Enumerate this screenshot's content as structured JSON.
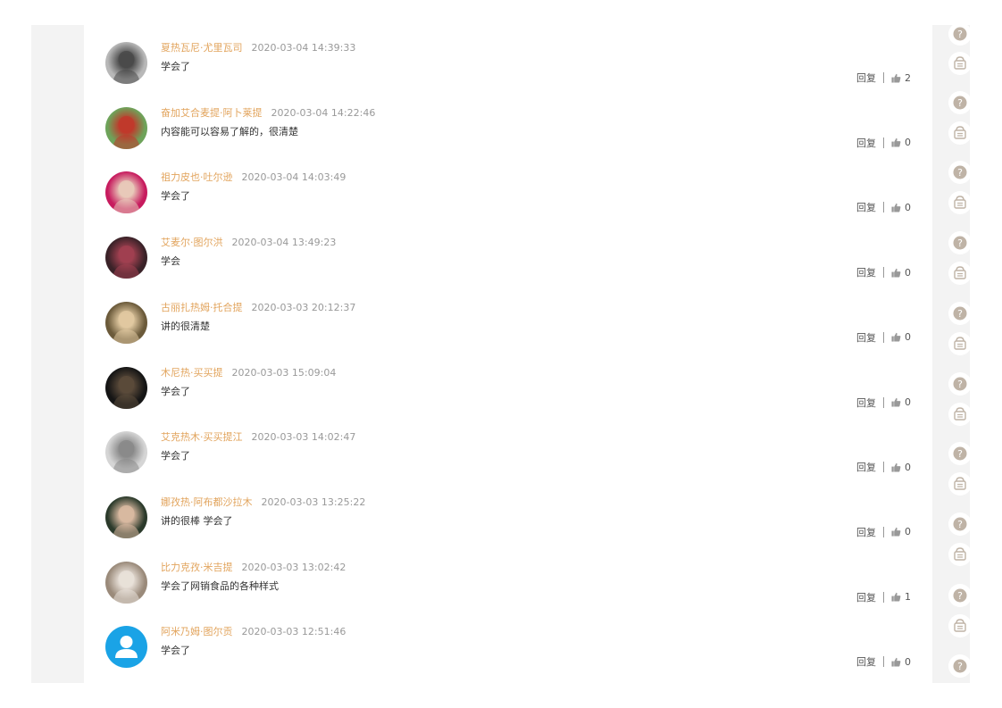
{
  "comments": [
    {
      "author": "夏热瓦尼·尤里瓦司",
      "time": "2020-03-04 14:39:33",
      "text": "学会了",
      "reply_label": "回复",
      "likes": "2",
      "avatar": {
        "kind": "photo",
        "bg": "#b8b8b8",
        "fg": "#4a4a4a"
      }
    },
    {
      "author": "奋加艾合麦提·阿卜莱提",
      "time": "2020-03-04 14:22:46",
      "text": "内容能可以容易了解的，很清楚",
      "reply_label": "回复",
      "likes": "0",
      "avatar": {
        "kind": "photo",
        "bg": "#6ea35a",
        "fg": "#c0392b"
      }
    },
    {
      "author": "祖力皮也·吐尔逊",
      "time": "2020-03-04 14:03:49",
      "text": "学会了",
      "reply_label": "回复",
      "likes": "0",
      "avatar": {
        "kind": "photo",
        "bg": "#c71b5e",
        "fg": "#e8c9b9"
      }
    },
    {
      "author": "艾麦尔·图尔洪",
      "time": "2020-03-04 13:49:23",
      "text": "学会",
      "reply_label": "回复",
      "likes": "0",
      "avatar": {
        "kind": "photo",
        "bg": "#3a2228",
        "fg": "#a04050"
      }
    },
    {
      "author": "古丽扎热姆·托合提",
      "time": "2020-03-03 20:12:37",
      "text": "讲的很清楚",
      "reply_label": "回复",
      "likes": "0",
      "avatar": {
        "kind": "photo",
        "bg": "#6b5a3a",
        "fg": "#e0c8a0"
      }
    },
    {
      "author": "木尼热·买买提",
      "time": "2020-03-03 15:09:04",
      "text": "学会了",
      "reply_label": "回复",
      "likes": "0",
      "avatar": {
        "kind": "photo",
        "bg": "#151515",
        "fg": "#5a4a3a"
      }
    },
    {
      "author": "艾克热木·买买提江",
      "time": "2020-03-03 14:02:47",
      "text": "学会了",
      "reply_label": "回复",
      "likes": "0",
      "avatar": {
        "kind": "photo",
        "bg": "#d5d5d5",
        "fg": "#8a8a8a"
      }
    },
    {
      "author": "娜孜热·阿布都沙拉木",
      "time": "2020-03-03 13:25:22",
      "text": "讲的很棒 学会了",
      "reply_label": "回复",
      "likes": "0",
      "avatar": {
        "kind": "photo",
        "bg": "#2b3a2b",
        "fg": "#d8b8a0"
      }
    },
    {
      "author": "比力克孜·米吉提",
      "time": "2020-03-03 13:02:42",
      "text": "学会了网销食品的各种样式",
      "reply_label": "回复",
      "likes": "1",
      "avatar": {
        "kind": "photo",
        "bg": "#9a8a7a",
        "fg": "#e8e0d8"
      }
    },
    {
      "author": "阿米乃姆·图尔贡",
      "time": "2020-03-03 12:51:46",
      "text": "学会了",
      "reply_label": "回复",
      "likes": "0",
      "avatar": {
        "kind": "default",
        "bg": "#1aa3e6",
        "fg": "#ffffff"
      }
    }
  ],
  "right_toolbar": {
    "icons": [
      "question-icon",
      "bag-icon",
      "question-icon",
      "bag-icon",
      "question-icon",
      "bag-icon",
      "question-icon",
      "bag-icon",
      "question-icon",
      "bag-icon",
      "question-icon",
      "bag-icon",
      "question-icon",
      "bag-icon",
      "question-icon",
      "bag-icon",
      "question-icon",
      "bag-icon",
      "question-icon"
    ],
    "color": "#bfb3a6"
  },
  "colors": {
    "author": "#e2a45d",
    "time": "#999999",
    "text": "#333333"
  }
}
